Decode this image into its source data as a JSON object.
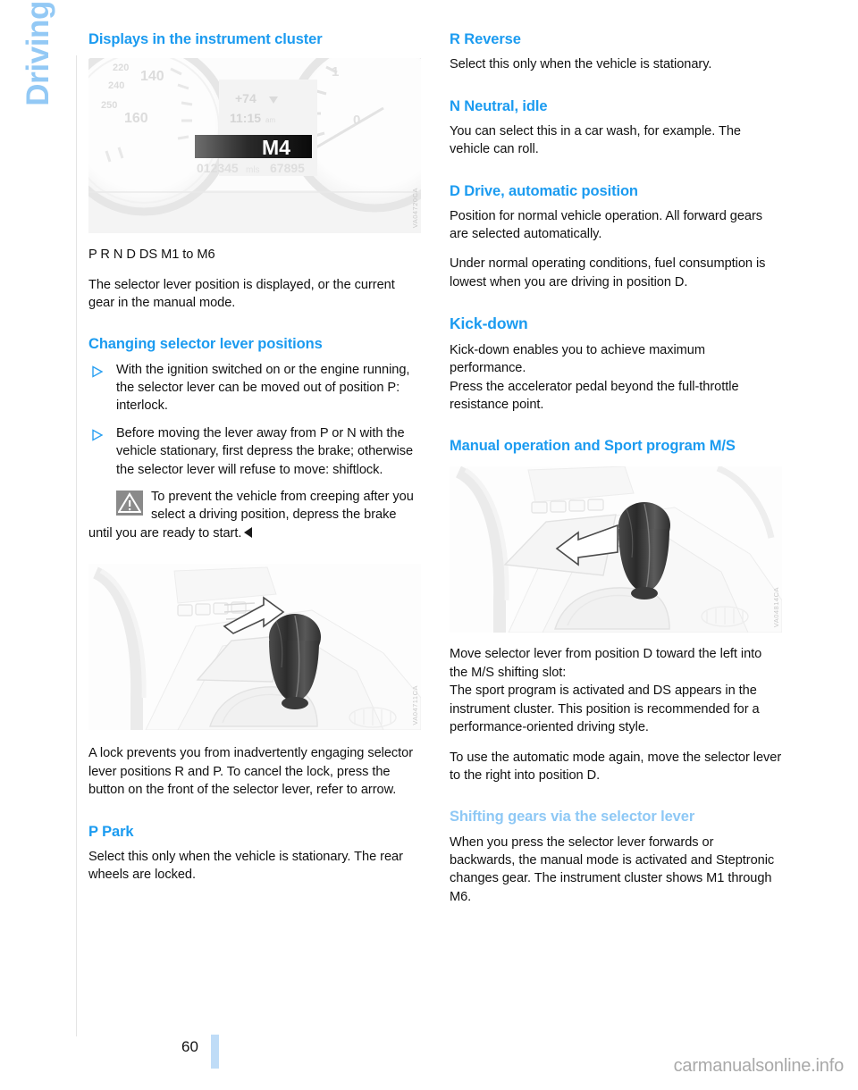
{
  "chapter": {
    "label": "Driving"
  },
  "page": {
    "number": "60",
    "watermark": "carmanualsonline.info"
  },
  "left": {
    "heading_displays": "Displays in the instrument cluster",
    "figure_cluster": {
      "code": "VA04720CA",
      "alt_name": "instrument-cluster-photo",
      "gauge_left_ticks": [
        "220",
        "240",
        "140",
        "160"
      ],
      "temp": "+74",
      "clock": "11:15 am",
      "gear_display": "M4",
      "odometer": "012345",
      "odometer_unit": "mls",
      "trip": "67895"
    },
    "positions_line": "P R N D DS M1 to M6",
    "positions_desc": "The selector lever position is displayed, or the current gear in the manual mode.",
    "heading_changing": "Changing selector lever positions",
    "bullets": [
      "With the ignition switched on or the engine running, the selector lever can be moved out of position P: interlock.",
      "Before moving the lever away from P or N with the vehicle stationary, first depress the brake; otherwise the selector lever will refuse to move: shiftlock."
    ],
    "note_text": "To prevent the vehicle from creeping after you select a driving position, depress the brake until you are ready to start.",
    "figure_lever": {
      "code": "VA04711CA",
      "alt_name": "selector-lever-console-photo"
    },
    "lock_paragraph": "A lock prevents you from inadvertently engaging selector lever positions R and P. To cancel the lock, press the button on the front of the selector lever, refer to arrow.",
    "heading_park": "P Park",
    "park_text": "Select this only when the vehicle is stationary. The rear wheels are locked."
  },
  "right": {
    "heading_reverse": "R Reverse",
    "reverse_text": "Select this only when the vehicle is stationary.",
    "heading_neutral": "N Neutral, idle",
    "neutral_text": "You can select this in a car wash, for example. The vehicle can roll.",
    "heading_drive": "D Drive, automatic position",
    "drive_text_1": "Position for normal vehicle operation. All forward gears are selected automatically.",
    "drive_text_2": "Under normal operating conditions, fuel consumption is lowest when you are driving in position D.",
    "heading_kickdown": "Kick-down",
    "kickdown_text": "Kick-down enables you to achieve maximum performance.\nPress the accelerator pedal beyond the full-throttle resistance point.",
    "heading_manual": "Manual operation and Sport program M/S",
    "figure_ms": {
      "code": "VA04814CA",
      "alt_name": "selector-lever-ms-slot-photo"
    },
    "manual_text_1": "Move selector lever from position D toward the left into the M/S shifting slot:\nThe sport program is activated and DS appears in the instrument cluster. This position is recommended for a performance-oriented driving style.",
    "manual_text_2": "To use the automatic mode again, move the selector lever to the right into position D.",
    "heading_shifting": "Shifting gears via the selector lever",
    "shifting_text": "When you press the selector lever forwards or backwards, the manual mode is activated and Steptronic changes gear. The instrument cluster shows M1 through M6."
  },
  "colors": {
    "heading_blue": "#1b9bf0",
    "heading_blue_pale": "#8ec8f5",
    "chapter_blue": "#93c9f5",
    "page_bar_blue": "#bfdcf7",
    "text_black": "#111111"
  }
}
